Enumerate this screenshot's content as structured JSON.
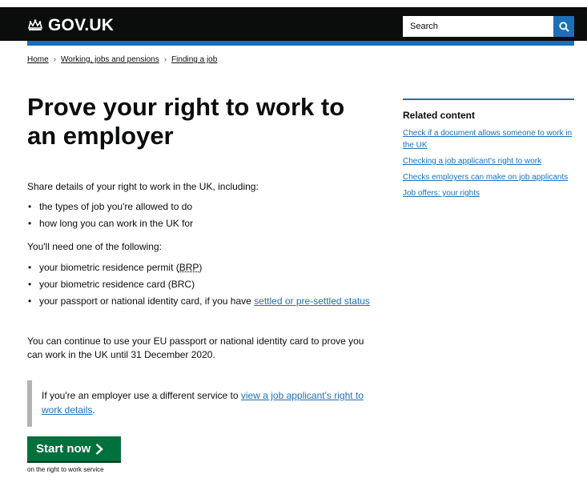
{
  "header": {
    "logo_text": "GOV.UK",
    "logo_icon": "crown-icon",
    "search_placeholder": "Search",
    "search_icon": "search-icon"
  },
  "colors": {
    "header_bg": "#0b0c0c",
    "brand_blue": "#1d70b8",
    "button_green": "#00703c",
    "inset_border": "#b1b4b6",
    "text": "#0b0c0c"
  },
  "breadcrumbs": [
    "Home",
    "Working, jobs and pensions",
    "Finding a job"
  ],
  "title": "Prove your right to work to an employer",
  "intro": "Share details of your right to work in the UK, including:",
  "list1": [
    "the types of job you're allowed to do",
    "how long you can work in the UK for"
  ],
  "need_text": "You'll need one of the following:",
  "list2": {
    "item1_pre": "your biometric residence permit (",
    "item1_abbr": "BRP",
    "item1_post": ")",
    "item2": "your biometric residence card (BRC)",
    "item3_text": "your passport or national identity card, if you have ",
    "item3_link": "settled or pre-settled status"
  },
  "eu_text": "You can continue to use your EU passport or national identity card to prove you can work in the UK until 31 December 2020.",
  "inset": {
    "text": "If you're an employer use a different service to ",
    "link": "view a job applicant's right to work details",
    "end": "."
  },
  "start_button": {
    "label": "Start now",
    "icon": "chevron-right-icon",
    "caption": "on the right to work service"
  },
  "related": {
    "heading": "Related content",
    "links": [
      "Check if a document allows someone to work in the UK",
      "Checking a job applicant's right to work",
      "Checks employers can make on job applicants",
      "Job offers: your rights"
    ]
  }
}
